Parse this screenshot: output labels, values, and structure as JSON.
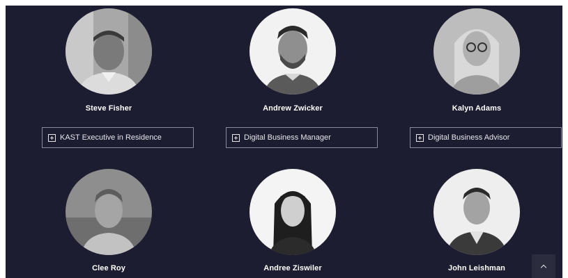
{
  "team": [
    {
      "name": "Steve Fisher",
      "role": "KAST Executive in Residence",
      "photo_tone": "#9a9a9a"
    },
    {
      "name": "Andrew Zwicker",
      "role": "Digital Business Manager",
      "photo_tone": "#f2f2f2"
    },
    {
      "name": "Kalyn Adams",
      "role": "Digital Business Advisor",
      "photo_tone": "#c8c8c8"
    },
    {
      "name": "Clee Roy",
      "photo_tone": "#8e8e8e"
    },
    {
      "name": "Andree Ziswiler",
      "photo_tone": "#f4f4f4"
    },
    {
      "name": "John Leishman",
      "photo_tone": "#eeeeee"
    }
  ],
  "icons": {
    "expand": "plus-square-icon",
    "scroll_top": "chevron-up-icon"
  },
  "colors": {
    "background": "#1c1d30",
    "text": "#ffffff",
    "border": "#8a8c9c"
  }
}
